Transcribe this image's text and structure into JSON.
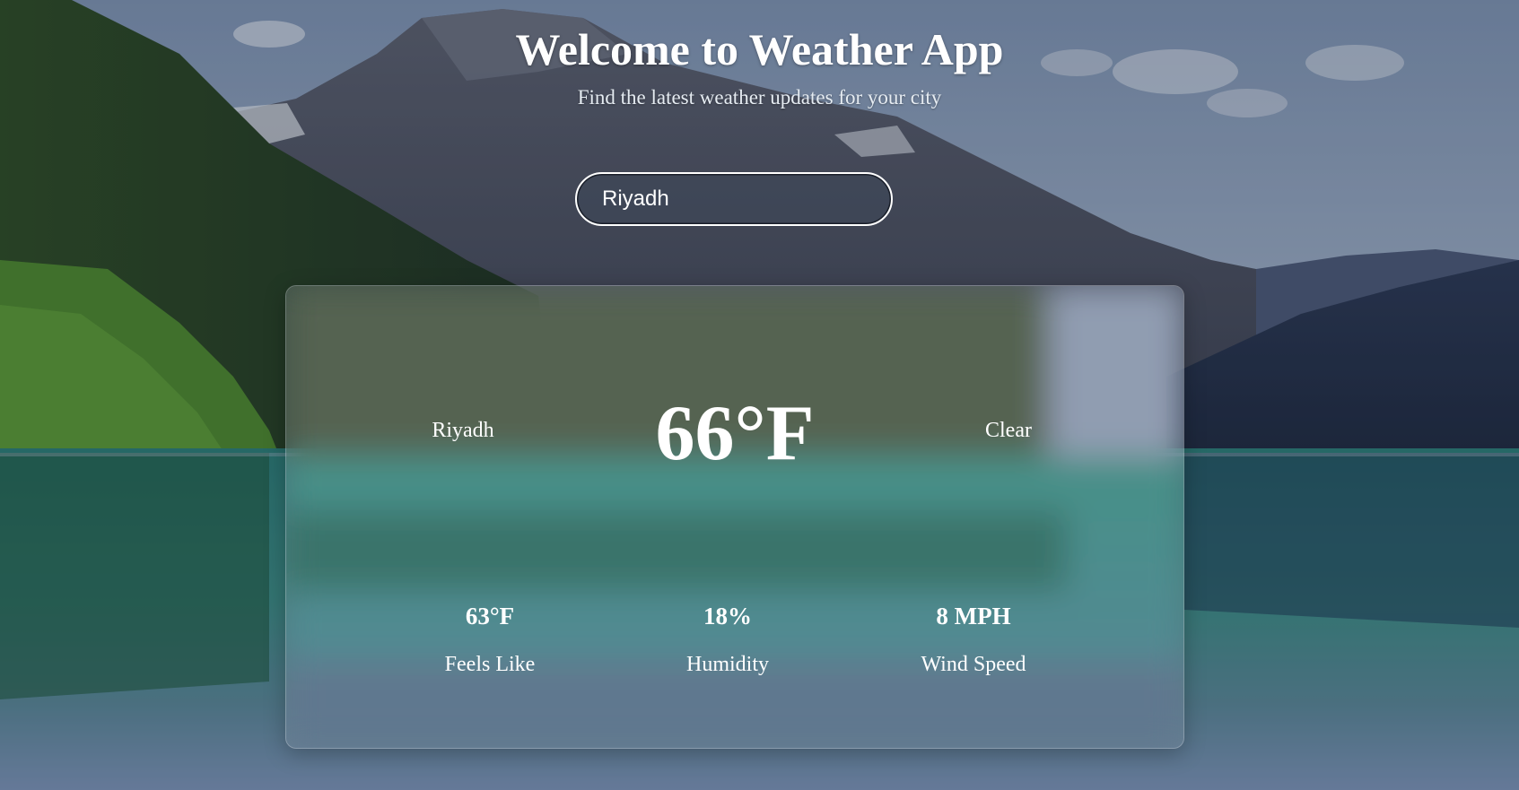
{
  "header": {
    "title": "Welcome to Weather App",
    "subtitle": "Find the latest weather updates for your city"
  },
  "search": {
    "value": "Riyadh",
    "placeholder": ""
  },
  "weather": {
    "city": "Riyadh",
    "temperature": "66°F",
    "condition": "Clear"
  },
  "stats": [
    {
      "value": "63°F",
      "label": "Feels Like"
    },
    {
      "value": "18%",
      "label": "Humidity"
    },
    {
      "value": "8 MPH",
      "label": "Wind Speed"
    }
  ],
  "colors": {
    "text": "#ffffff",
    "sky": "#9fb3c9",
    "lake": "#2f8a86",
    "forest": "#2d4a2a"
  }
}
